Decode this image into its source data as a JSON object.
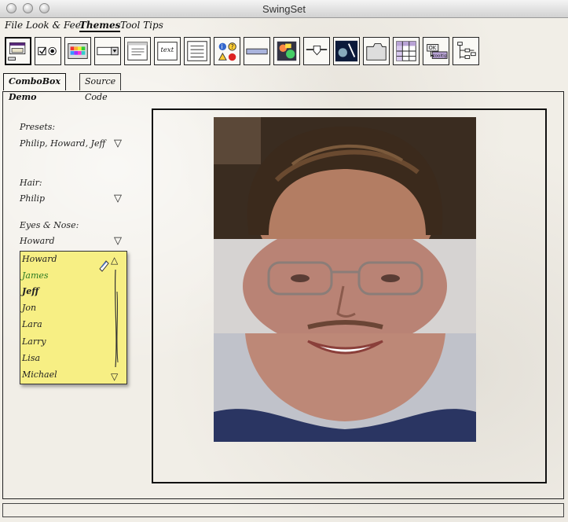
{
  "window": {
    "title": "SwingSet"
  },
  "menubar": {
    "items": [
      "File",
      "Look & Feel",
      "Themes",
      "Tool Tips"
    ],
    "active": "Themes"
  },
  "toolbar": {
    "buttons": [
      {
        "icon": "internal-frame-icon"
      },
      {
        "icon": "checkbox-radio-icon"
      },
      {
        "icon": "color-chooser-icon"
      },
      {
        "icon": "combobox-icon"
      },
      {
        "icon": "file-chooser-icon"
      },
      {
        "icon": "editor-pane-icon",
        "text": "text"
      },
      {
        "icon": "list-icon"
      },
      {
        "icon": "option-pane-icon"
      },
      {
        "icon": "progress-bar-icon"
      },
      {
        "icon": "scroll-pane-icon"
      },
      {
        "icon": "slider-icon"
      },
      {
        "icon": "split-pane-icon"
      },
      {
        "icon": "tabbed-pane-icon"
      },
      {
        "icon": "table-icon"
      },
      {
        "icon": "tooltip-icon",
        "text_top": "OK",
        "text_bottom": "tooltip"
      },
      {
        "icon": "tree-icon"
      }
    ]
  },
  "tabs": [
    {
      "label": "ComboBox Demo",
      "selected": true
    },
    {
      "label": "Source Code",
      "selected": false
    }
  ],
  "controls": {
    "presets_label": "Presets:",
    "presets_value": "Philip, Howard, Jeff",
    "hair_label": "Hair:",
    "hair_value": "Philip",
    "eyes_label": "Eyes & Nose:",
    "eyes_value": "Howard"
  },
  "dropdown": {
    "items": [
      "Howard",
      "James",
      "Jeff",
      "Jon",
      "Lara",
      "Larry",
      "Lisa",
      "Michael"
    ],
    "highlighted": "James",
    "bold": "Jeff",
    "background": "#f7ef84"
  },
  "colors": {
    "highlight_text": "#2c7a22",
    "paper": "#f1eee7"
  }
}
